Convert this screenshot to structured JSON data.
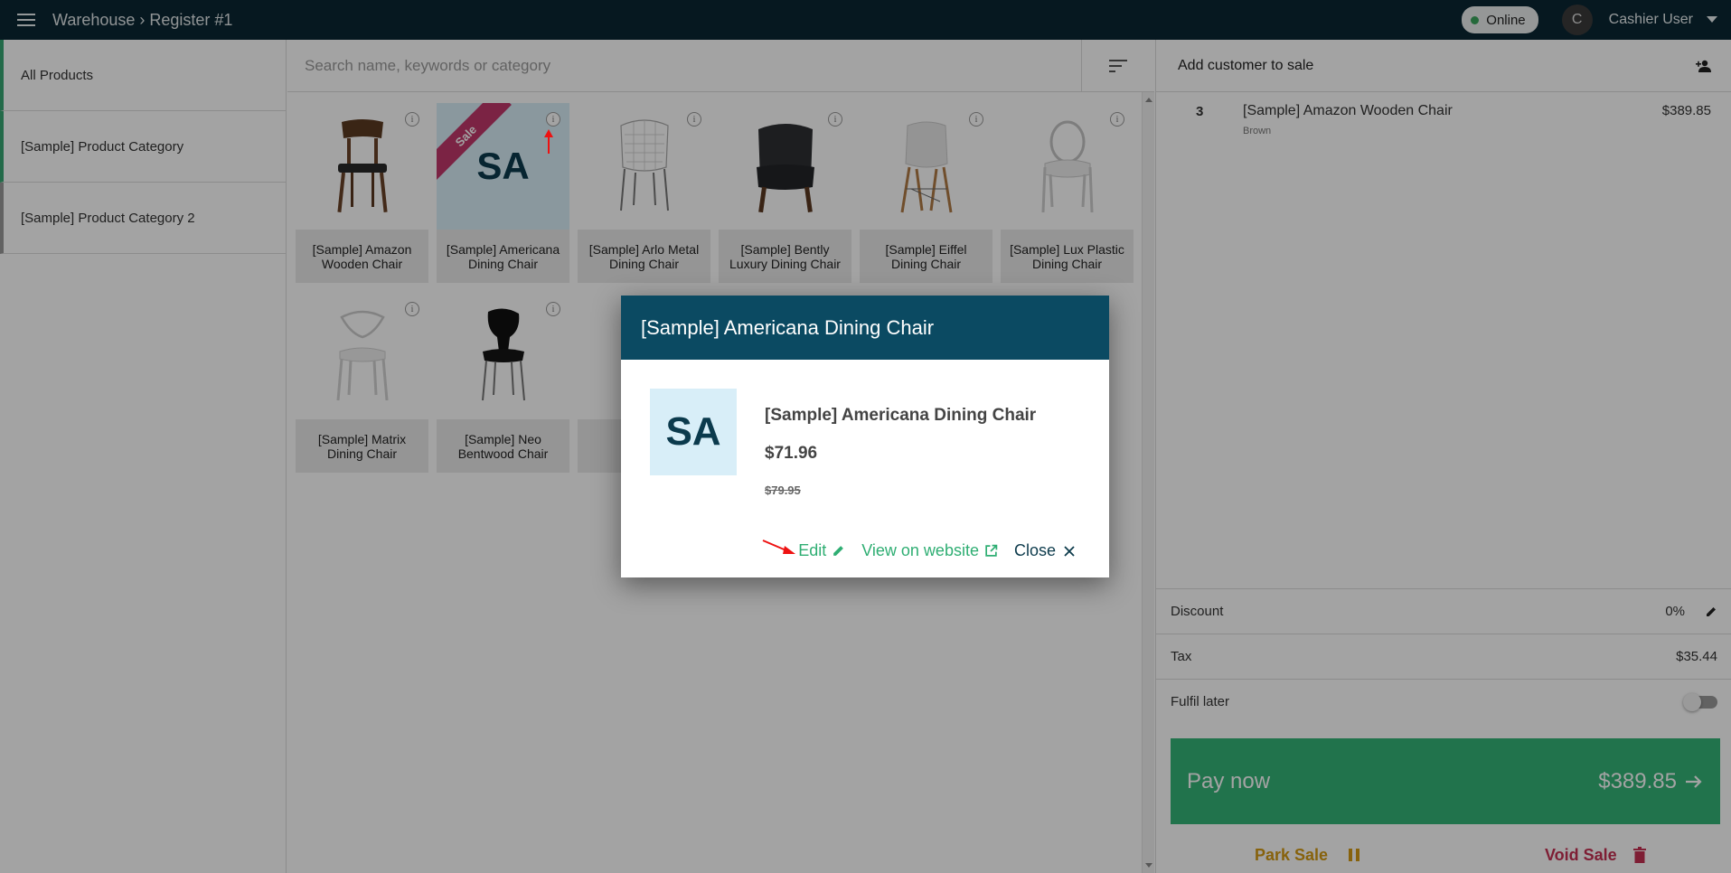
{
  "topbar": {
    "breadcrumb": "Warehouse › Register #1",
    "status": "Online",
    "avatar_initial": "C",
    "user_name": "Cashier User",
    "colors": {
      "bar": "#0a2633",
      "online": "#3aa55d"
    }
  },
  "sidebar": {
    "items": [
      {
        "label": "All Products"
      },
      {
        "label": "[Sample] Product Category"
      },
      {
        "label": "[Sample] Product Category 2"
      }
    ]
  },
  "search": {
    "placeholder": "Search name, keywords or category"
  },
  "products": [
    {
      "label": "[Sample] Amazon Wooden Chair",
      "icon": "chair-brown-icon"
    },
    {
      "label": "[Sample] Americana Dining Chair",
      "thumb_text": "SA",
      "ribbon": "Sale"
    },
    {
      "label": "[Sample] Arlo Metal Dining Chair",
      "icon": "wire-chair-icon"
    },
    {
      "label": "[Sample] Bently Luxury Dining Chair",
      "icon": "armchair-dark-icon"
    },
    {
      "label": "[Sample] Eiffel Dining Chair",
      "icon": "eiffel-chair-icon"
    },
    {
      "label": "[Sample] Lux Plastic Dining Chair",
      "icon": "ghost-chair-icon"
    },
    {
      "label": "[Sample] Matrix Dining Chair",
      "icon": "white-chair-icon"
    },
    {
      "label": "[Sample] Neo Bentwood Chair",
      "icon": "black-chair-icon"
    }
  ],
  "cart": {
    "add_customer": "Add customer to sale",
    "items": [
      {
        "qty": "3",
        "name": "[Sample] Amazon Wooden Chair",
        "variant": "Brown",
        "price": "$389.85"
      }
    ],
    "discount_label": "Discount",
    "discount_value": "0%",
    "tax_label": "Tax",
    "tax_value": "$35.44",
    "fulfil_label": "Fulfil later",
    "pay_label": "Pay now",
    "pay_amount": "$389.85",
    "park_label": "Park Sale",
    "void_label": "Void Sale",
    "colors": {
      "pay": "#34b478",
      "park": "#d39a13",
      "void": "#c53052"
    }
  },
  "dialog": {
    "title": "[Sample] Americana Dining Chair",
    "thumb_text": "SA",
    "name": "[Sample] Americana Dining Chair",
    "price": "$71.96",
    "old_price": "$79.95",
    "edit_label": "Edit",
    "website_label": "View on website",
    "close_label": "Close",
    "colors": {
      "header": "#0b4a62",
      "link": "#2fae73"
    }
  }
}
